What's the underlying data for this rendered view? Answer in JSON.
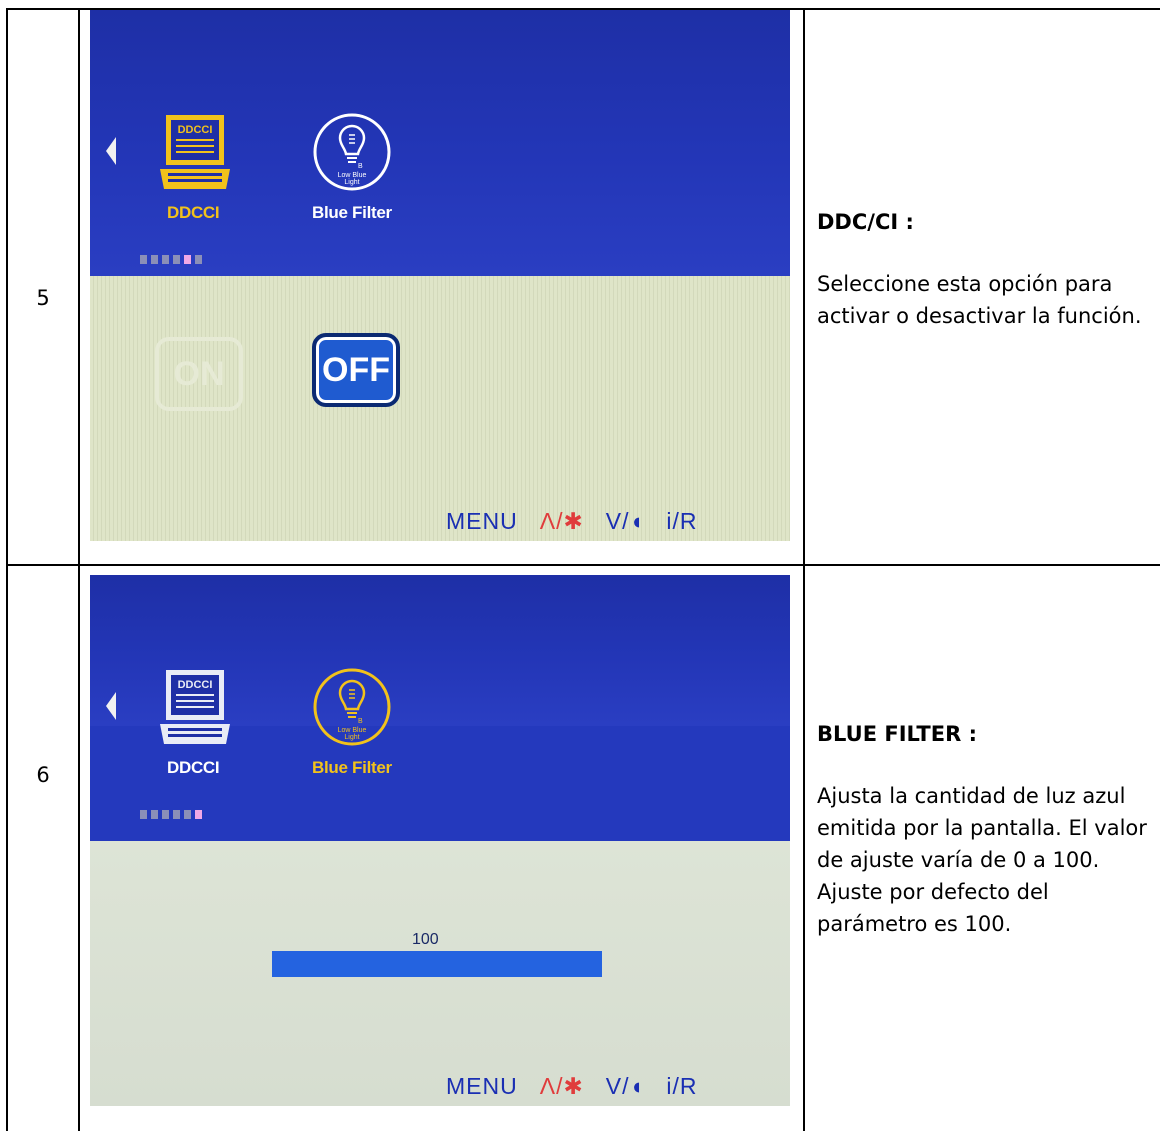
{
  "rows": [
    {
      "number": "5",
      "title": "DDC/CI :",
      "body": "Seleccione esta opción para activar o desactivar la función.",
      "osd": {
        "items": [
          {
            "icon": "monitor-icon",
            "icon_text": "DDCCI",
            "label": "DDCCI"
          },
          {
            "icon": "bulb-icon",
            "icon_text": "Low Blue Light",
            "label": "Blue Filter"
          }
        ],
        "selected_item": "DDCCI",
        "on_label": "ON",
        "off_label": "OFF",
        "selected_option": "OFF",
        "footer": {
          "menu": "MENU",
          "up": "Λ/✱",
          "down": "V/◖",
          "ir": "i/R"
        },
        "colors": {
          "selected": "#f2c21b",
          "unselected": "#ffffff"
        }
      }
    },
    {
      "number": "6",
      "title": "BLUE FILTER :",
      "body": "Ajusta la cantidad de luz azul emitida por la pantalla. El valor de ajuste varía de 0 a 100. Ajuste por defecto del parámetro es 100.",
      "osd": {
        "items": [
          {
            "icon": "monitor-icon",
            "icon_text": "DDCCI",
            "label": "DDCCI"
          },
          {
            "icon": "bulb-icon",
            "icon_text": "Low Blue Light",
            "label": "Blue Filter"
          }
        ],
        "selected_item": "Blue Filter",
        "value": "100",
        "level": 1.0,
        "footer": {
          "menu": "MENU",
          "up": "Λ/✱",
          "down": "V/◖",
          "ir": "i/R"
        },
        "colors": {
          "selected": "#f2c21b",
          "unselected": "#ffffff",
          "slider": "#2463e0"
        }
      }
    }
  ]
}
